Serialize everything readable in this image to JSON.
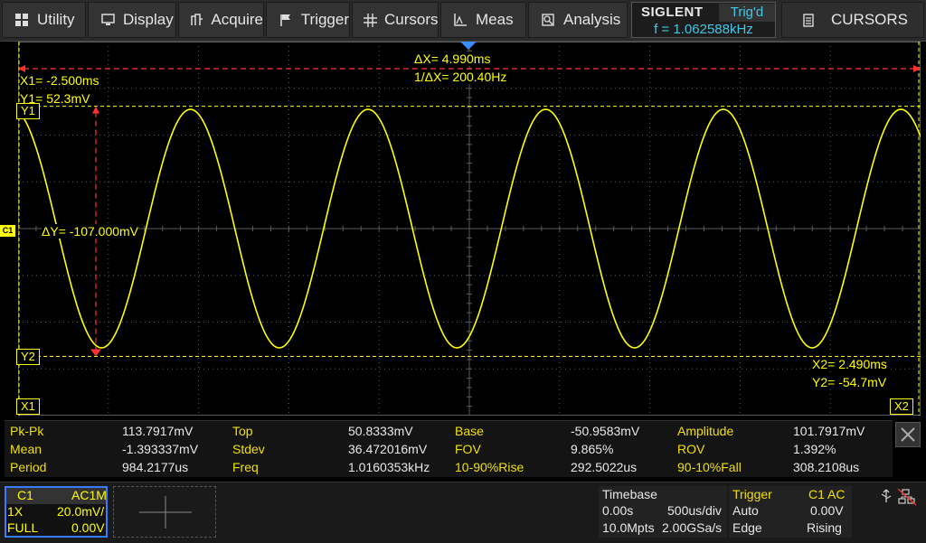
{
  "menu": {
    "items": [
      {
        "label": "Utility",
        "icon": "grid-icon"
      },
      {
        "label": "Display",
        "icon": "monitor-icon"
      },
      {
        "label": "Acquire",
        "icon": "acquire-icon"
      },
      {
        "label": "Trigger",
        "icon": "flag-icon"
      },
      {
        "label": "Cursors",
        "icon": "crosshair-icon"
      },
      {
        "label": "Meas",
        "icon": "measure-icon"
      },
      {
        "label": "Analysis",
        "icon": "analysis-icon"
      }
    ],
    "brand": "SIGLENT",
    "trig_status": "Trig'd",
    "trigger_freq": "f = 1.062588kHz",
    "right_label": "CURSORS",
    "right_icon": "document-icon"
  },
  "colors": {
    "trace": "#ffff00",
    "cursor_x": "#ff3030",
    "grid": "#5a5a5a",
    "accent": "#40c8e8"
  },
  "cursors": {
    "x1": "X1= -2.500ms",
    "y1": "Y1= 52.3mV",
    "delta_x": "ΔX= 4.990ms",
    "inv_delta_x": "1/ΔX= 200.40Hz",
    "delta_y": "ΔY= -107.000mV",
    "x2": "X2= 2.490ms",
    "y2": "Y2= -54.7mV",
    "tag_y1": "Y1",
    "tag_y2": "Y2",
    "tag_x1": "X1",
    "tag_x2": "X2",
    "channel_marker": "C1"
  },
  "measurements": [
    [
      {
        "name": "Pk-Pk",
        "value": "113.7917mV"
      },
      {
        "name": "Top",
        "value": "50.8333mV"
      },
      {
        "name": "Base",
        "value": "-50.9583mV"
      },
      {
        "name": "Amplitude",
        "value": "101.7917mV"
      }
    ],
    [
      {
        "name": "Mean",
        "value": "-1.393337mV"
      },
      {
        "name": "Stdev",
        "value": "36.472016mV"
      },
      {
        "name": "FOV",
        "value": "9.865%"
      },
      {
        "name": "ROV",
        "value": "1.392%"
      }
    ],
    [
      {
        "name": "Period",
        "value": "984.2177us"
      },
      {
        "name": "Freq",
        "value": "1.0160353kHz"
      },
      {
        "name": "10-90%Rise",
        "value": "292.5022us"
      },
      {
        "name": "90-10%Fall",
        "value": "308.2108us"
      }
    ]
  ],
  "channel": {
    "name": "C1",
    "coupling": "AC1M",
    "probe": "1X",
    "scale": "20.0mV/",
    "bandwidth": "FULL",
    "offset": "0.00V"
  },
  "timebase": {
    "title": "Timebase",
    "delay": "0.00s",
    "scale": "500us/div",
    "memory": "10.0Mpts",
    "sample_rate": "2.00GSa/s"
  },
  "trigger": {
    "title": "Trigger",
    "source": "C1 AC",
    "mode": "Auto",
    "level": "0.00V",
    "type": "Edge",
    "slope": "Rising"
  },
  "status_icons": [
    "usb-icon",
    "network-icon"
  ]
}
